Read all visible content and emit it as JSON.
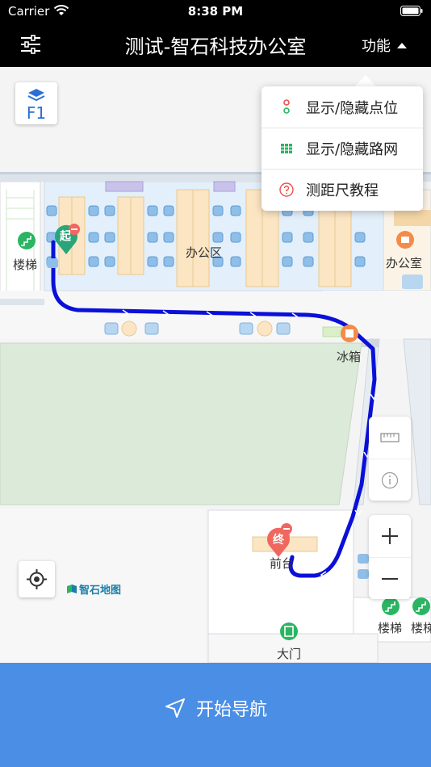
{
  "status_bar": {
    "carrier": "Carrier",
    "time": "8:38 PM"
  },
  "navbar": {
    "title": "测试-智石科技办公室",
    "function_label": "功能"
  },
  "floor": {
    "current": "F1"
  },
  "dropdown": {
    "items": [
      {
        "label": "显示/隐藏点位",
        "icon": "dots-icon"
      },
      {
        "label": "显示/隐藏路网",
        "icon": "grid-icon"
      },
      {
        "label": "测距尺教程",
        "icon": "help-icon"
      }
    ]
  },
  "map": {
    "labels": {
      "stairs_left": "楼梯",
      "office_area": "办公区",
      "office": "办公室",
      "fridge": "冰箱",
      "reception": "前台",
      "gate": "大门",
      "stairs_br1": "楼梯",
      "stairs_br2": "楼梯"
    },
    "markers": {
      "start": "起",
      "end": "终"
    },
    "brand": "智石地图"
  },
  "colors": {
    "route": "#0a10d8",
    "accent": "#4a8ee6",
    "start_marker": "#28a67a",
    "end_marker": "#f0675f"
  },
  "bottom": {
    "start_navigation": "开始导航"
  }
}
